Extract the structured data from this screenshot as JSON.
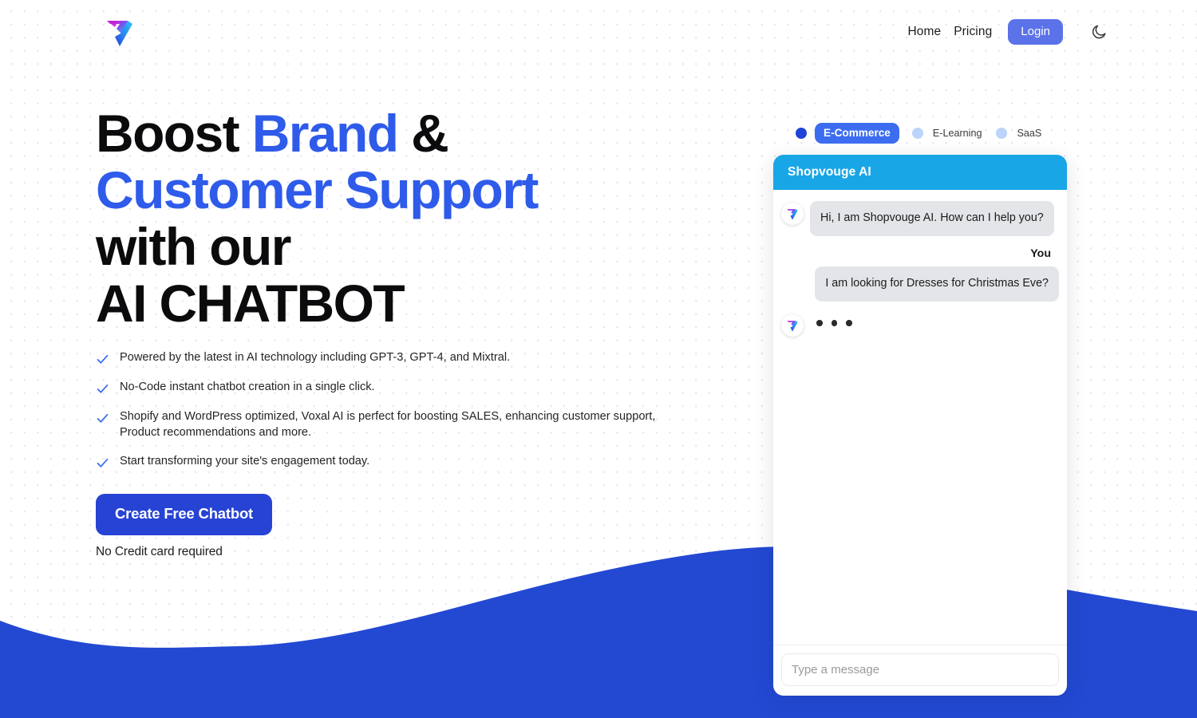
{
  "brand": {
    "logo_name": "voxal-v-logo",
    "gradient_start": "#c31fd6",
    "gradient_mid": "#7b4df0",
    "gradient_end": "#20b9f2"
  },
  "header": {
    "nav_links": [
      {
        "label": "Home"
      },
      {
        "label": "Pricing"
      }
    ],
    "login_label": "Login",
    "login_color": "#5b72e8",
    "theme_toggle_icon": "moon-icon"
  },
  "hero": {
    "headline": {
      "line1_black": "Boost ",
      "line1_blue": "Brand",
      "line1_tail": " &",
      "line2_blue": "Customer Support",
      "line3": "with our",
      "line4": "AI CHATBOT"
    },
    "accent_color": "#2f5bea",
    "features": [
      {
        "icon": "check-icon",
        "text": "Powered by the latest in AI technology including GPT-3, GPT-4, and Mixtral."
      },
      {
        "icon": "check-icon",
        "text": "No-Code instant chatbot creation in a single click."
      },
      {
        "icon": "check-icon",
        "text": "Shopify and WordPress optimized, Voxal AI is perfect for boosting SALES, enhancing customer support, Product recommendations and more."
      },
      {
        "icon": "check-icon",
        "text": "Start transforming your site's engagement today."
      }
    ],
    "cta_label": "Create Free Chatbot",
    "cta_color": "#2743d4",
    "cta_note": "No Credit card required"
  },
  "demo": {
    "tabs": [
      {
        "label": "E-Commerce",
        "active": true
      },
      {
        "label": "E-Learning",
        "active": false
      },
      {
        "label": "SaaS",
        "active": false
      }
    ],
    "chat": {
      "header_title": "Shopvouge AI",
      "header_color": "#18a6e6",
      "messages": [
        {
          "from": "bot",
          "avatar": "bot-avatar-icon",
          "text": "Hi, I am Shopvouge AI. How can I help you?"
        },
        {
          "from": "user",
          "sender_label": "You",
          "text": "I am looking for Dresses for Christmas Eve?"
        },
        {
          "from": "bot",
          "avatar": "bot-avatar-icon",
          "typing": true
        }
      ],
      "input_placeholder": "Type a message",
      "input_value": ""
    }
  },
  "decoration": {
    "wave_color": "#2349d2",
    "dot_grid_color": "#e9e9ea"
  }
}
